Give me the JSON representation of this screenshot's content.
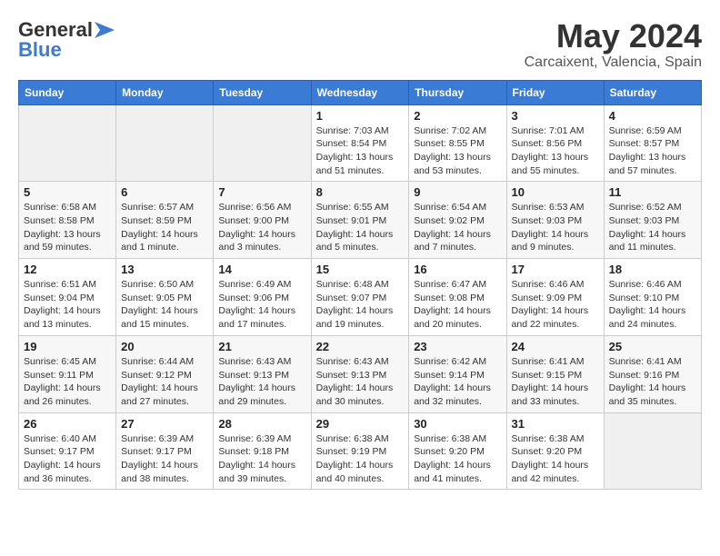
{
  "header": {
    "logo_line1": "General",
    "logo_line2": "Blue",
    "title": "May 2024",
    "location": "Carcaixent, Valencia, Spain"
  },
  "days_of_week": [
    "Sunday",
    "Monday",
    "Tuesday",
    "Wednesday",
    "Thursday",
    "Friday",
    "Saturday"
  ],
  "weeks": [
    [
      {
        "day": "",
        "info": ""
      },
      {
        "day": "",
        "info": ""
      },
      {
        "day": "",
        "info": ""
      },
      {
        "day": "1",
        "info": "Sunrise: 7:03 AM\nSunset: 8:54 PM\nDaylight: 13 hours\nand 51 minutes."
      },
      {
        "day": "2",
        "info": "Sunrise: 7:02 AM\nSunset: 8:55 PM\nDaylight: 13 hours\nand 53 minutes."
      },
      {
        "day": "3",
        "info": "Sunrise: 7:01 AM\nSunset: 8:56 PM\nDaylight: 13 hours\nand 55 minutes."
      },
      {
        "day": "4",
        "info": "Sunrise: 6:59 AM\nSunset: 8:57 PM\nDaylight: 13 hours\nand 57 minutes."
      }
    ],
    [
      {
        "day": "5",
        "info": "Sunrise: 6:58 AM\nSunset: 8:58 PM\nDaylight: 13 hours\nand 59 minutes."
      },
      {
        "day": "6",
        "info": "Sunrise: 6:57 AM\nSunset: 8:59 PM\nDaylight: 14 hours\nand 1 minute."
      },
      {
        "day": "7",
        "info": "Sunrise: 6:56 AM\nSunset: 9:00 PM\nDaylight: 14 hours\nand 3 minutes."
      },
      {
        "day": "8",
        "info": "Sunrise: 6:55 AM\nSunset: 9:01 PM\nDaylight: 14 hours\nand 5 minutes."
      },
      {
        "day": "9",
        "info": "Sunrise: 6:54 AM\nSunset: 9:02 PM\nDaylight: 14 hours\nand 7 minutes."
      },
      {
        "day": "10",
        "info": "Sunrise: 6:53 AM\nSunset: 9:03 PM\nDaylight: 14 hours\nand 9 minutes."
      },
      {
        "day": "11",
        "info": "Sunrise: 6:52 AM\nSunset: 9:03 PM\nDaylight: 14 hours\nand 11 minutes."
      }
    ],
    [
      {
        "day": "12",
        "info": "Sunrise: 6:51 AM\nSunset: 9:04 PM\nDaylight: 14 hours\nand 13 minutes."
      },
      {
        "day": "13",
        "info": "Sunrise: 6:50 AM\nSunset: 9:05 PM\nDaylight: 14 hours\nand 15 minutes."
      },
      {
        "day": "14",
        "info": "Sunrise: 6:49 AM\nSunset: 9:06 PM\nDaylight: 14 hours\nand 17 minutes."
      },
      {
        "day": "15",
        "info": "Sunrise: 6:48 AM\nSunset: 9:07 PM\nDaylight: 14 hours\nand 19 minutes."
      },
      {
        "day": "16",
        "info": "Sunrise: 6:47 AM\nSunset: 9:08 PM\nDaylight: 14 hours\nand 20 minutes."
      },
      {
        "day": "17",
        "info": "Sunrise: 6:46 AM\nSunset: 9:09 PM\nDaylight: 14 hours\nand 22 minutes."
      },
      {
        "day": "18",
        "info": "Sunrise: 6:46 AM\nSunset: 9:10 PM\nDaylight: 14 hours\nand 24 minutes."
      }
    ],
    [
      {
        "day": "19",
        "info": "Sunrise: 6:45 AM\nSunset: 9:11 PM\nDaylight: 14 hours\nand 26 minutes."
      },
      {
        "day": "20",
        "info": "Sunrise: 6:44 AM\nSunset: 9:12 PM\nDaylight: 14 hours\nand 27 minutes."
      },
      {
        "day": "21",
        "info": "Sunrise: 6:43 AM\nSunset: 9:13 PM\nDaylight: 14 hours\nand 29 minutes."
      },
      {
        "day": "22",
        "info": "Sunrise: 6:43 AM\nSunset: 9:13 PM\nDaylight: 14 hours\nand 30 minutes."
      },
      {
        "day": "23",
        "info": "Sunrise: 6:42 AM\nSunset: 9:14 PM\nDaylight: 14 hours\nand 32 minutes."
      },
      {
        "day": "24",
        "info": "Sunrise: 6:41 AM\nSunset: 9:15 PM\nDaylight: 14 hours\nand 33 minutes."
      },
      {
        "day": "25",
        "info": "Sunrise: 6:41 AM\nSunset: 9:16 PM\nDaylight: 14 hours\nand 35 minutes."
      }
    ],
    [
      {
        "day": "26",
        "info": "Sunrise: 6:40 AM\nSunset: 9:17 PM\nDaylight: 14 hours\nand 36 minutes."
      },
      {
        "day": "27",
        "info": "Sunrise: 6:39 AM\nSunset: 9:17 PM\nDaylight: 14 hours\nand 38 minutes."
      },
      {
        "day": "28",
        "info": "Sunrise: 6:39 AM\nSunset: 9:18 PM\nDaylight: 14 hours\nand 39 minutes."
      },
      {
        "day": "29",
        "info": "Sunrise: 6:38 AM\nSunset: 9:19 PM\nDaylight: 14 hours\nand 40 minutes."
      },
      {
        "day": "30",
        "info": "Sunrise: 6:38 AM\nSunset: 9:20 PM\nDaylight: 14 hours\nand 41 minutes."
      },
      {
        "day": "31",
        "info": "Sunrise: 6:38 AM\nSunset: 9:20 PM\nDaylight: 14 hours\nand 42 minutes."
      },
      {
        "day": "",
        "info": ""
      }
    ]
  ]
}
